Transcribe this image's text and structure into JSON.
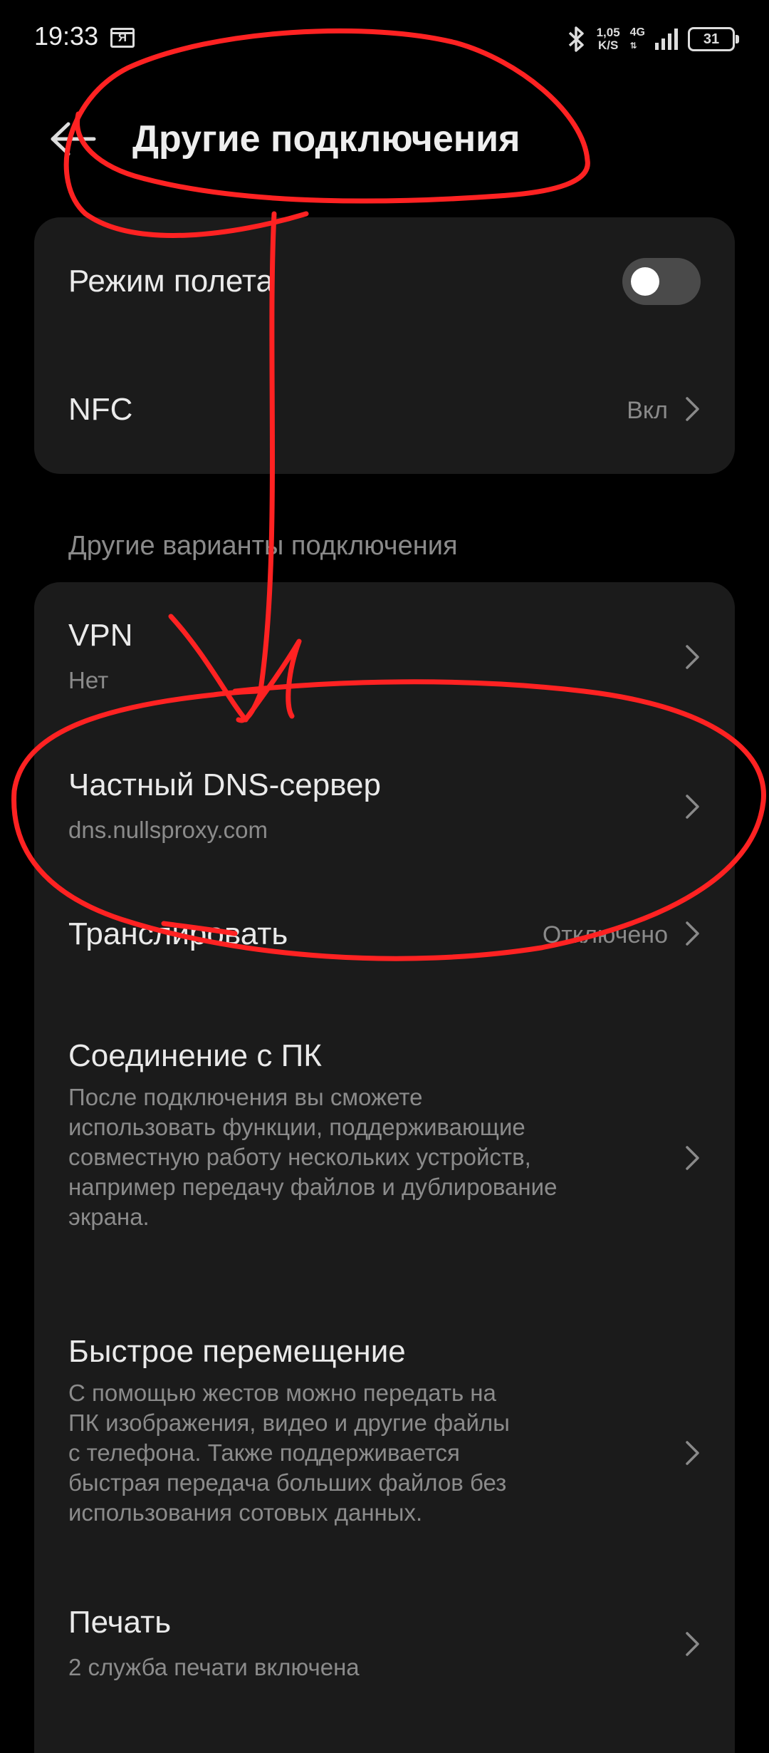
{
  "status_bar": {
    "time": "19:33",
    "app_icon_letter": "Я",
    "bluetooth_icon": "bluetooth-icon",
    "net_speed_value": "1,05",
    "net_speed_unit": "K/S",
    "network_type": "4G",
    "battery_level": "31"
  },
  "header": {
    "back_icon": "arrow-left-icon",
    "title": "Другие подключения"
  },
  "main_card": {
    "airplane_mode": {
      "label": "Режим полета",
      "enabled": false
    },
    "nfc": {
      "label": "NFC",
      "value": "Вкл"
    }
  },
  "section_label": "Другие варианты подключения",
  "options": {
    "vpn": {
      "label": "VPN",
      "sub": "Нет"
    },
    "private_dns": {
      "label": "Частный DNS-сервер",
      "sub": "dns.nullsproxy.com"
    },
    "cast": {
      "label": "Транслировать",
      "value": "Отключено"
    },
    "pc_connection": {
      "label": "Соединение с ПК",
      "desc_lines": [
        "После подключения вы сможете",
        "использовать функции, поддерживающие",
        "совместную работу нескольких устройств,",
        "например передачу файлов и дублирование",
        "экрана."
      ]
    },
    "quick_transfer": {
      "label": "Быстрое перемещение",
      "desc_lines": [
        "С помощью жестов можно передать на",
        "ПК изображения, видео и другие файлы",
        "с телефона. Также поддерживается",
        "быстрая передача больших файлов без",
        "использования сотовых данных."
      ]
    },
    "print": {
      "label": "Печать",
      "sub": "2 служба печати включена"
    }
  },
  "annotation": {
    "color": "#ff2222"
  }
}
